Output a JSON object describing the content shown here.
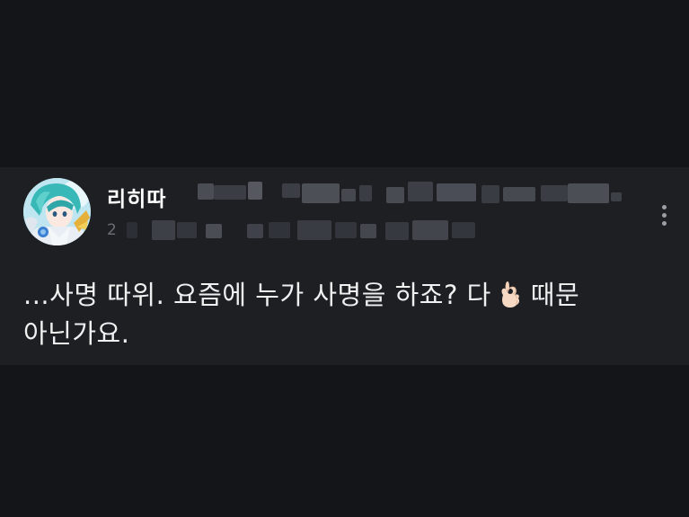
{
  "colors": {
    "page_background": "#141519",
    "post_background": "#1d1f23",
    "text_primary": "#f0f0f0",
    "text_secondary": "#6b6e75"
  },
  "post": {
    "author_name": "리히따",
    "meta_line_1_start": "",
    "meta_line_2_start": "2",
    "menu_icon": "more-vertical-icon",
    "text_before_emoji": "...사명 따위. 요즘에 누가 사명을 하죠? 다",
    "emoji_icon": "ok-hand-emoji-icon",
    "text_after_emoji": "때문",
    "text_line_2": "아닌가요."
  }
}
